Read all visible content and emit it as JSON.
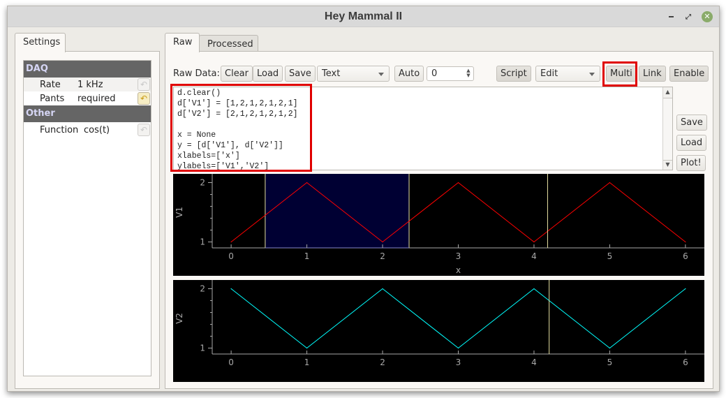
{
  "window": {
    "title": "Hey Mammal II",
    "controls": {
      "minimize": "minimize-icon",
      "maximize": "maximize-icon",
      "close": "close-icon"
    }
  },
  "settings": {
    "tab_label": "Settings",
    "groups": [
      {
        "name": "DAQ",
        "params": [
          {
            "name": "Rate",
            "value": "1 kHz",
            "modified": false
          },
          {
            "name": "Pants",
            "value": "required",
            "modified": true
          }
        ]
      },
      {
        "name": "Other",
        "params": [
          {
            "name": "Function",
            "value": "cos(t)",
            "modified": false
          }
        ]
      }
    ],
    "reset_glyph": "↶"
  },
  "tabs": [
    {
      "label": "Raw",
      "active": true
    },
    {
      "label": "Processed",
      "active": false
    }
  ],
  "toolbar": {
    "raw_data_label": "Raw Data:",
    "clear": "Clear",
    "load": "Load",
    "save": "Save",
    "format_select": "Text",
    "auto": "Auto",
    "spin_value": "0",
    "script": "Script",
    "mode_select": "Edit",
    "multi": "Multi",
    "link": "Link",
    "enable": "Enable"
  },
  "editor": {
    "lines": [
      "d.clear()",
      "d['V1'] = [1,2,1,2,1,2,1]",
      "d['V2'] = [2,1,2,1,2,1,2]",
      "",
      "x = None",
      "y = [d['V1'], d['V2']]",
      "xlabels=['x']",
      "ylabels=['V1','V2']"
    ]
  },
  "side_buttons": {
    "save": "Save",
    "load": "Load",
    "plot": "Plot!"
  },
  "highlight_color": "#e00000",
  "chart_data": [
    {
      "type": "line",
      "x": [
        0,
        1,
        2,
        3,
        4,
        5,
        6
      ],
      "series": [
        {
          "name": "V1",
          "values": [
            1,
            2,
            1,
            2,
            1,
            2,
            1
          ],
          "color": "#ff0000"
        }
      ],
      "ylabel": "V1",
      "xlabel": "x",
      "xticks": [
        "0",
        "1",
        "2",
        "3",
        "4",
        "5",
        "6"
      ],
      "yticks": [
        "1",
        "2"
      ],
      "xlim": [
        -0.25,
        6.25
      ],
      "ylim": [
        0.9,
        2.1
      ],
      "region": {
        "x0": 0.45,
        "x1": 2.35,
        "color": "#000033"
      },
      "cursor_x": 4.18,
      "background": "#000000"
    },
    {
      "type": "line",
      "x": [
        0,
        1,
        2,
        3,
        4,
        5,
        6
      ],
      "series": [
        {
          "name": "V2",
          "values": [
            2,
            1,
            2,
            1,
            2,
            1,
            2
          ],
          "color": "#00ffff"
        }
      ],
      "ylabel": "V2",
      "xlabel": "",
      "xticks": [
        "0",
        "1",
        "2",
        "3",
        "4",
        "5",
        "6"
      ],
      "yticks": [
        "1",
        "2"
      ],
      "xlim": [
        -0.25,
        6.25
      ],
      "ylim": [
        0.9,
        2.1
      ],
      "cursor_x": 4.2,
      "background": "#000000"
    }
  ]
}
